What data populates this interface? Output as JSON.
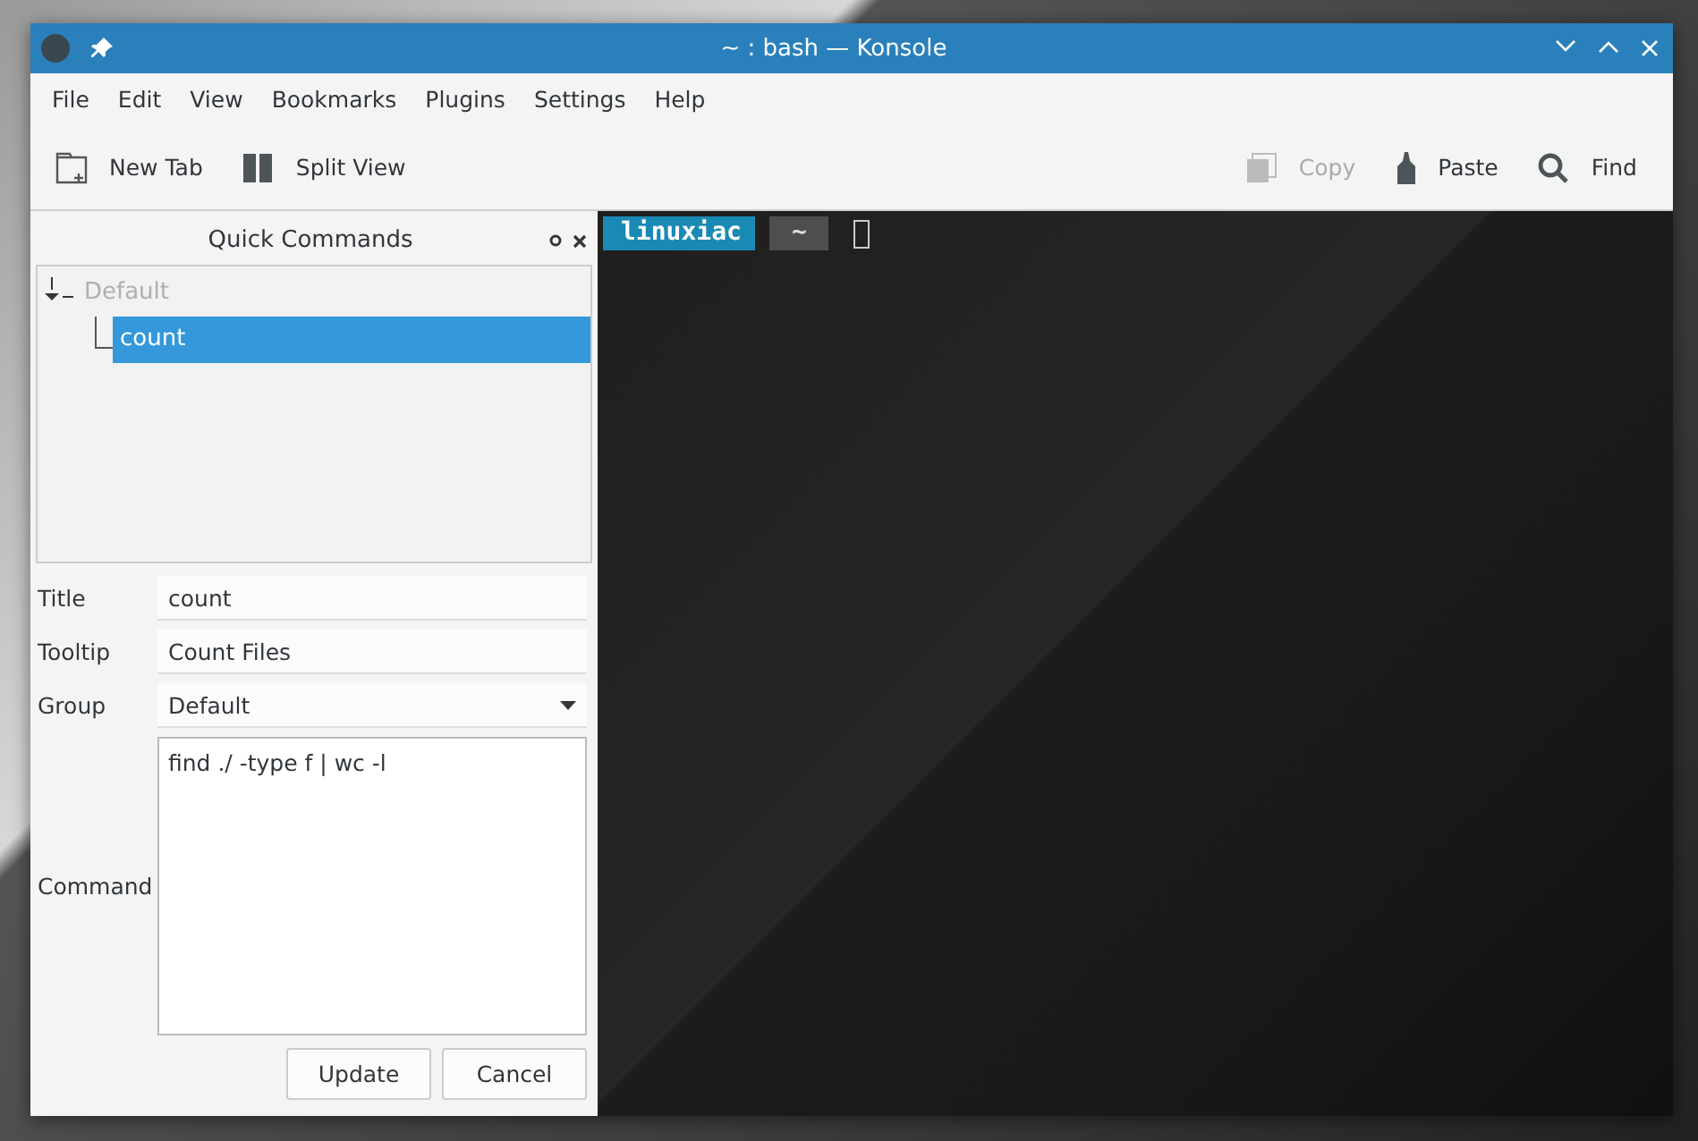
{
  "window": {
    "title": "~ : bash — Konsole"
  },
  "menu": [
    "File",
    "Edit",
    "View",
    "Bookmarks",
    "Plugins",
    "Settings",
    "Help"
  ],
  "toolbar": [
    {
      "label": "New Tab",
      "kind": "newtab",
      "disabled": false
    },
    {
      "label": "Split View",
      "kind": "split",
      "disabled": false
    },
    {
      "label": "Copy",
      "kind": "copy",
      "disabled": true
    },
    {
      "label": "Paste",
      "kind": "paste",
      "disabled": false
    },
    {
      "label": "Find",
      "kind": "find",
      "disabled": false
    }
  ],
  "panel": {
    "title": "Quick Commands",
    "tree": [
      {
        "label": "Default",
        "expanded": true,
        "selected": false,
        "children": [
          {
            "label": "count",
            "selected": true
          }
        ]
      }
    ],
    "fields": [
      {
        "label": "Title",
        "kind": "text",
        "value": "count"
      },
      {
        "label": "Tooltip",
        "kind": "text",
        "value": "Count Files"
      },
      {
        "label": "Group",
        "kind": "select",
        "value": "Default"
      },
      {
        "label": "Command",
        "kind": "textarea",
        "value": "find ./ -type f | wc -l"
      }
    ],
    "buttons": [
      "Update",
      "Cancel"
    ]
  },
  "terminal": {
    "prompt": [
      {
        "text": "linuxiac",
        "kind": "user"
      },
      {
        "text": "~",
        "kind": "dir"
      }
    ]
  }
}
